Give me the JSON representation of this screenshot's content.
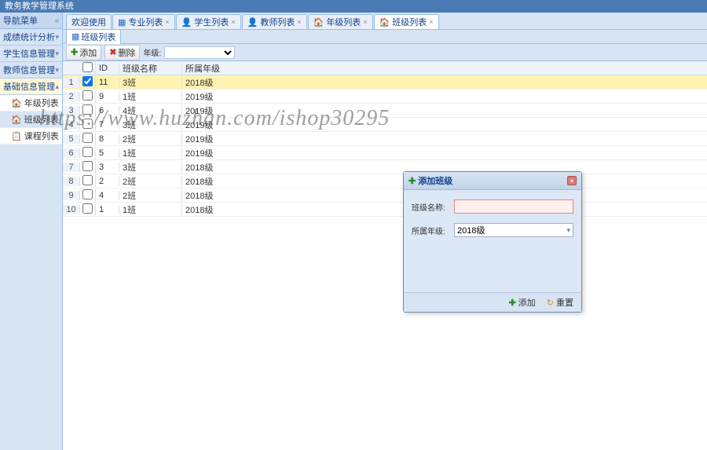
{
  "title": "教务教学管理系统",
  "sidebar": {
    "header": "导航菜单",
    "groups": [
      {
        "label": "成绩统计分析"
      },
      {
        "label": "学生信息管理"
      },
      {
        "label": "教师信息管理"
      },
      {
        "label": "基础信息管理",
        "active": true
      }
    ],
    "subitems": [
      {
        "label": "年级列表",
        "icon": "🏠"
      },
      {
        "label": "班级列表",
        "icon": "🏠",
        "active": true
      },
      {
        "label": "课程列表",
        "icon": "📋"
      }
    ]
  },
  "tabs": [
    {
      "label": "欢迎使用",
      "closable": false
    },
    {
      "label": "专业列表",
      "closable": true
    },
    {
      "label": "学生列表",
      "closable": true
    },
    {
      "label": "教师列表",
      "closable": true
    },
    {
      "label": "年级列表",
      "closable": true
    },
    {
      "label": "班级列表",
      "closable": true,
      "active": true
    }
  ],
  "subtab": "班级列表",
  "toolbar": {
    "add": "添加",
    "del": "删除",
    "grade_label": "年级:",
    "grade_value": ""
  },
  "grid": {
    "headers": {
      "id": "ID",
      "name": "班级名称",
      "grade": "所属年级"
    },
    "rows": [
      {
        "id": "11",
        "name": "3班",
        "grade": "2018级",
        "selected": true,
        "checked": true
      },
      {
        "id": "9",
        "name": "1班",
        "grade": "2019级"
      },
      {
        "id": "6",
        "name": "4班",
        "grade": "2019级"
      },
      {
        "id": "7",
        "name": "3班",
        "grade": "2019级"
      },
      {
        "id": "8",
        "name": "2班",
        "grade": "2019级"
      },
      {
        "id": "5",
        "name": "1班",
        "grade": "2019级"
      },
      {
        "id": "3",
        "name": "3班",
        "grade": "2018级"
      },
      {
        "id": "2",
        "name": "2班",
        "grade": "2018级"
      },
      {
        "id": "4",
        "name": "2班",
        "grade": "2018级"
      },
      {
        "id": "1",
        "name": "1班",
        "grade": "2018级"
      }
    ]
  },
  "dialog": {
    "title": "添加班级",
    "name_label": "班级名称:",
    "name_value": "",
    "grade_label": "所属年级:",
    "grade_value": "2018级",
    "btn_add": "添加",
    "btn_reset": "重置"
  },
  "watermark": "https://www.huzhan.com/ishop30295"
}
